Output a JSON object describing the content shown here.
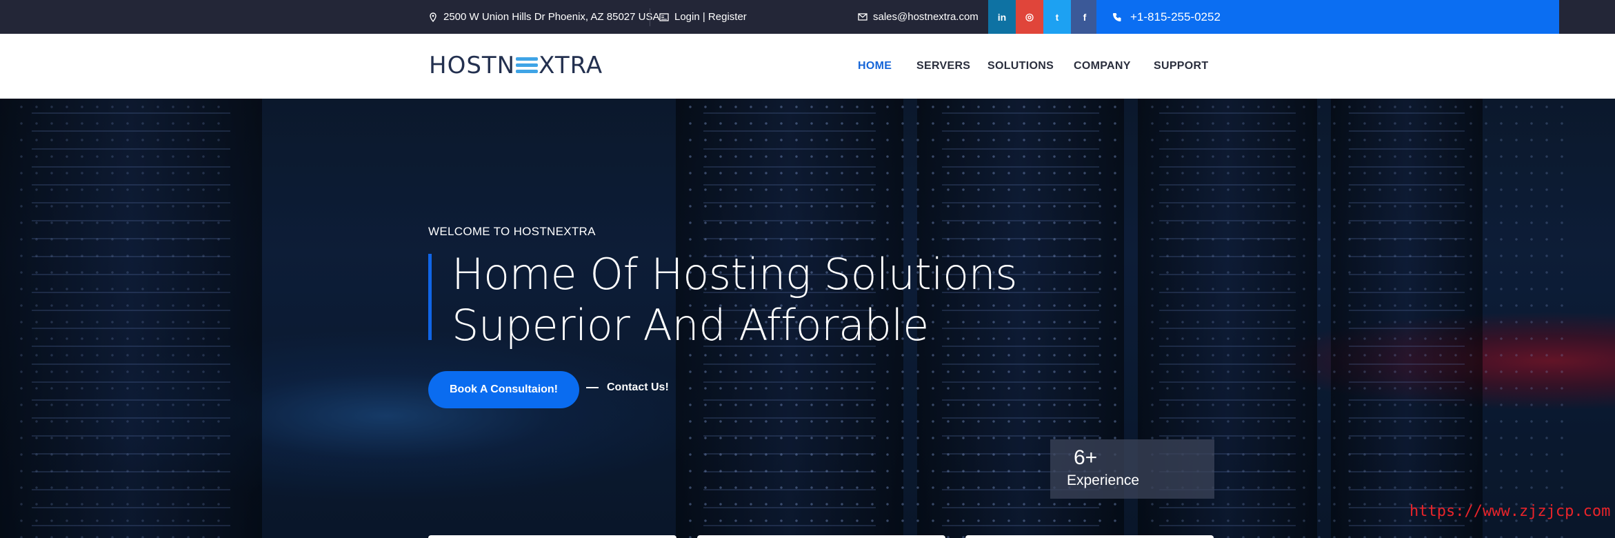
{
  "topbar": {
    "address": "2500 W Union Hills Dr Phoenix, AZ 85027 USA",
    "login": "Login | Register",
    "email": "sales@hostnextra.com",
    "phone": "+1-815-255-0252",
    "social": [
      {
        "label": "in",
        "icon": "linkedin-icon",
        "color": "#0e72a3"
      },
      {
        "label": "◎",
        "icon": "instagram-icon",
        "color": "#e0453a"
      },
      {
        "label": "t",
        "icon": "twitter-icon",
        "color": "#1da1f2"
      },
      {
        "label": "f",
        "icon": "facebook-icon",
        "color": "#3b5998"
      }
    ]
  },
  "header": {
    "logo_left": "HOSTN",
    "logo_right": "XTRA",
    "nav": [
      "HOME",
      "SERVERS",
      "SOLUTIONS",
      "COMPANY",
      "SUPPORT"
    ],
    "active": "HOME"
  },
  "hero": {
    "welcome": "WELCOME TO HOSTNEXTRA",
    "title_line1": "Home Of Hosting Solutions",
    "title_line2": "Superior And Afforable",
    "cta_primary": "Book A Consultaion!",
    "cta_secondary": "Contact Us!",
    "stat_value": "6+",
    "stat_label": "Experience"
  },
  "watermark": "https://www.zjzjcp.com",
  "colors": {
    "accent": "#0b6ef2",
    "topbar": "#232637"
  }
}
